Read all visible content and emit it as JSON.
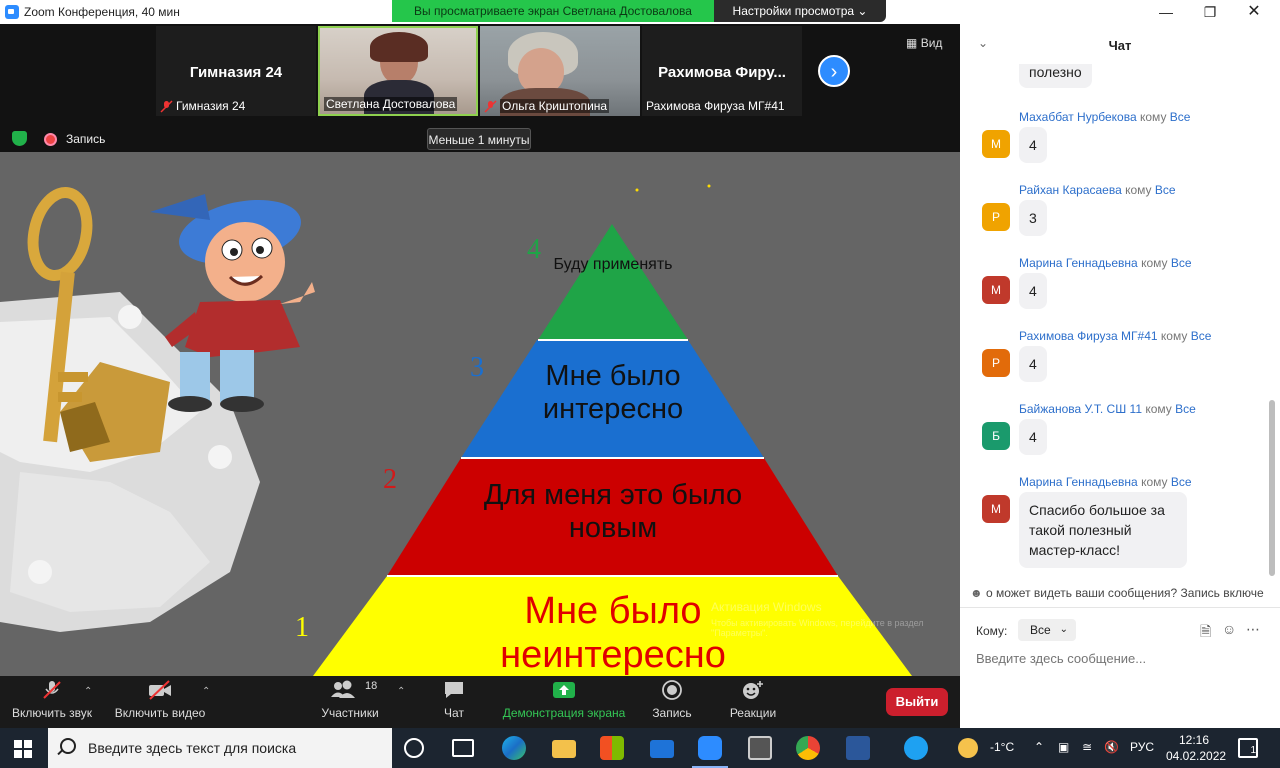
{
  "window": {
    "title": "Zoom Конференция, 40 мин",
    "share_banner": "Вы просматриваете экран Светлана Достовалова",
    "view_settings": "Настройки просмотра ⌄"
  },
  "strip": {
    "tiles": [
      {
        "big_name": "Гимназия 24",
        "label": "Гимназия 24",
        "muted": true
      },
      {
        "big_name": "",
        "label": "Светлана Достовалова",
        "muted": false
      },
      {
        "big_name": "",
        "label": "Ольга Криштопина",
        "muted": true
      },
      {
        "big_name": "Рахимова  Фиру...",
        "label": "Рахимова Фируза МГ#41",
        "muted": false
      }
    ],
    "view_label": "Вид",
    "record_label": "Запись",
    "timer": "Меньше 1 минуты"
  },
  "slide": {
    "levels": [
      {
        "number": "4",
        "text": "Буду применять",
        "fill": "#1fa447",
        "number_color": "#1fa447",
        "text_color": "#111111"
      },
      {
        "number": "3",
        "text": "Мне было интересно",
        "fill": "#1a6fd0",
        "number_color": "#1a6fd0",
        "text_color": "#111111"
      },
      {
        "number": "2",
        "text": "Для меня это было новым",
        "fill": "#cc0000",
        "number_color": "#d21a1a",
        "text_color": "#111111"
      },
      {
        "number": "1",
        "text": "Мне было неинтересно",
        "fill": "#ffff00",
        "number_color": "#ffff00",
        "text_color": "#e00000"
      }
    ],
    "watermark_title": "Активация Windows",
    "watermark_sub": "Чтобы активировать Windows, перейдите в раздел \"Параметры\"."
  },
  "toolbar": {
    "mute": "Включить звук",
    "video": "Включить видео",
    "participants": "Участники",
    "participants_count": "18",
    "chat": "Чат",
    "share": "Демонстрация экрана",
    "record": "Запись",
    "reactions": "Реакции",
    "exit": "Выйти"
  },
  "chat": {
    "title": "Чат",
    "to_word": "кому",
    "messages": [
      {
        "initial": "",
        "sender": "",
        "target": "",
        "text": "полезно",
        "color": ""
      },
      {
        "initial": "М",
        "sender": "Махаббат Нурбекова",
        "target": "Все",
        "text": "4",
        "color": "#f0a300"
      },
      {
        "initial": "Р",
        "sender": "Райхан Карасаева",
        "target": "Все",
        "text": "3",
        "color": "#f0a300"
      },
      {
        "initial": "М",
        "sender": "Марина Геннадьевна",
        "target": "Все",
        "text": "4",
        "color": "#c0392b"
      },
      {
        "initial": "Р",
        "sender": "Рахимова Фируза МГ#41",
        "target": "Все",
        "text": "4",
        "color": "#e26b0a"
      },
      {
        "initial": "Б",
        "sender": "Байжанова У.Т. СШ 11",
        "target": "Все",
        "text": "4",
        "color": "#1a9a6c"
      },
      {
        "initial": "М",
        "sender": "Марина Геннадьевна",
        "target": "Все",
        "text": "Спасибо большое за такой полезный мастер-класс!",
        "color": "#c0392b"
      }
    ],
    "privacy_note": "о может видеть ваши сообщения? Запись включе",
    "to_label": "Кому:",
    "to_value": "Все",
    "input_placeholder": "Введите здесь сообщение..."
  },
  "taskbar": {
    "search_placeholder": "Введите здесь текст для поиска",
    "temperature": "-1°C",
    "language": "РУС",
    "time": "12:16",
    "date": "04.02.2022",
    "notifications": "1"
  }
}
